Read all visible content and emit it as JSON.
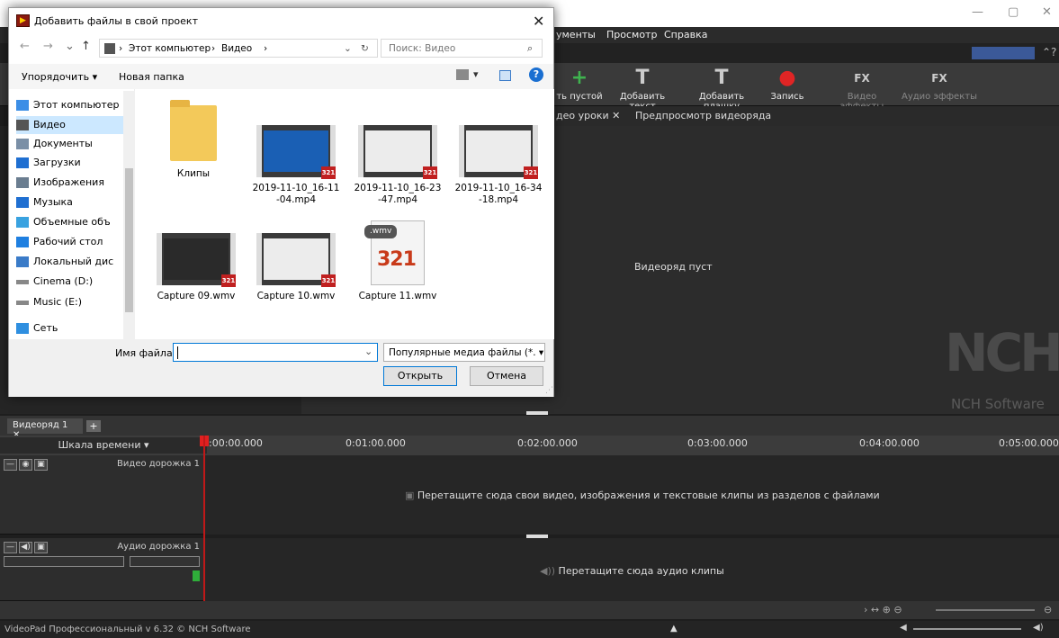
{
  "app": {
    "menu": [
      "ументы",
      "Просмотр",
      "Справка"
    ],
    "ribbon": [
      {
        "label": "ть пустой",
        "icon": "add-blank-icon"
      },
      {
        "label": "Добавить текст",
        "icon": "add-text-icon"
      },
      {
        "label": "Добавить плашку",
        "icon": "add-title-icon"
      },
      {
        "label": "Запись",
        "icon": "record-icon"
      },
      {
        "label": "Видео эффекты",
        "icon": "video-fx-icon"
      },
      {
        "label": "Аудио эффекты",
        "icon": "audio-fx-icon"
      }
    ],
    "tabs": {
      "lessons": "део уроки ✕",
      "preview": "Предпросмотр видеоряда"
    },
    "preview_empty": "Видеоряд пуст",
    "logo_text": "NCH",
    "logo_sub": "NCH Software",
    "sequence_tab": "Видеоряд 1 ✕",
    "timeline_label": "Шкала времени",
    "timeline_ticks": [
      ":00:00.000",
      "0:01:00.000",
      "0:02:00.000",
      "0:03:00.000",
      "0:04:00.000",
      "0:05:00.000"
    ],
    "video_track": "Видео дорожка 1",
    "audio_track": "Аудио дорожка 1",
    "video_hint": "Перетащите сюда свои видео, изображения и текстовые клипы из разделов с файлами",
    "audio_hint": "Перетащите сюда аудио клипы",
    "status": "VideoPad Профессиональный v 6.32 © NCH Software"
  },
  "dialog": {
    "title": "Добавить файлы в свой проект",
    "path": [
      "Этот компьютер",
      "Видео"
    ],
    "search_placeholder": "Поиск: Видео",
    "organize": "Упорядочить ▾",
    "new_folder": "Новая папка",
    "nav": [
      {
        "label": "Этот компьютер",
        "color": "#3c8ee6"
      },
      {
        "label": "Видео",
        "color": "#555",
        "selected": true
      },
      {
        "label": "Документы",
        "color": "#7a8fa6"
      },
      {
        "label": "Загрузки",
        "color": "#1f6fd1"
      },
      {
        "label": "Изображения",
        "color": "#6a7d90"
      },
      {
        "label": "Музыка",
        "color": "#1f6fd1"
      },
      {
        "label": "Объемные объ",
        "color": "#39a2e0"
      },
      {
        "label": "Рабочий стол",
        "color": "#1f7fe0"
      },
      {
        "label": "Локальный дис",
        "color": "#3a7bc8"
      },
      {
        "label": "Cinema (D:)",
        "color": "#888"
      },
      {
        "label": "Music (E:)",
        "color": "#888"
      },
      {
        "label": "Сеть",
        "color": "#2f8fe0"
      }
    ],
    "files": [
      {
        "name": "Клипы",
        "kind": "folder"
      },
      {
        "name": "2019-11-10_16-11 -04.mp4",
        "kind": "video",
        "style": "blue"
      },
      {
        "name": "2019-11-10_16-23 -47.mp4",
        "kind": "video",
        "style": "light"
      },
      {
        "name": "2019-11-10_16-34 -18.mp4",
        "kind": "video",
        "style": "light"
      },
      {
        "name": "Capture 09.wmv",
        "kind": "video",
        "style": "dark"
      },
      {
        "name": "Capture 10.wmv",
        "kind": "video",
        "style": "light"
      },
      {
        "name": "Capture 11.wmv",
        "kind": "wmv"
      }
    ],
    "badge": "321",
    "wmv_tag": ".wmv",
    "filename_label": "Имя файла:",
    "filename_value": "",
    "filter": "Популярные медиа файлы (*. ▾",
    "open_label": "Открыть",
    "cancel_label": "Отмена"
  }
}
